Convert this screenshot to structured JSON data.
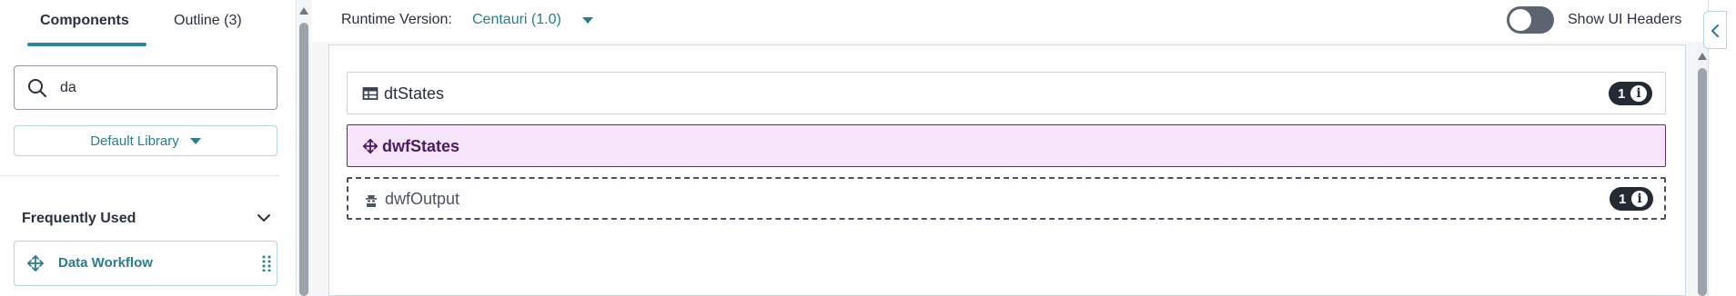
{
  "left_panel": {
    "tabs": [
      {
        "label": "Components",
        "active": true
      },
      {
        "label": "Outline (3)",
        "active": false
      }
    ],
    "search": {
      "value": "da",
      "icon": "search-icon"
    },
    "library": {
      "label": "Default Library"
    },
    "sections": [
      {
        "title": "Frequently Used",
        "expanded": true,
        "items": [
          {
            "label": "Data Workflow",
            "icon": "move-arrows-icon"
          }
        ]
      }
    ]
  },
  "runtime": {
    "label": "Runtime Version:",
    "value": "Centauri (1.0)"
  },
  "ui_headers": {
    "label": "Show UI Headers",
    "on": false
  },
  "canvas": {
    "components": [
      {
        "name": "dtStates",
        "icon": "table-icon",
        "badge_count": "1",
        "badge_icon": "info-icon",
        "selected": false
      },
      {
        "name": "dwfStates",
        "icon": "move-arrows-icon",
        "selected": true
      },
      {
        "name": "dwfOutput",
        "icon": "hidden-user-icon",
        "badge_count": "1",
        "badge_icon": "info-icon",
        "selected": false,
        "hidden": true
      }
    ]
  },
  "colors": {
    "accent": "#2a7d90",
    "selected_bg": "#f7e6fb",
    "selected_border": "#5a2e6c",
    "badge_bg": "#232a33"
  }
}
